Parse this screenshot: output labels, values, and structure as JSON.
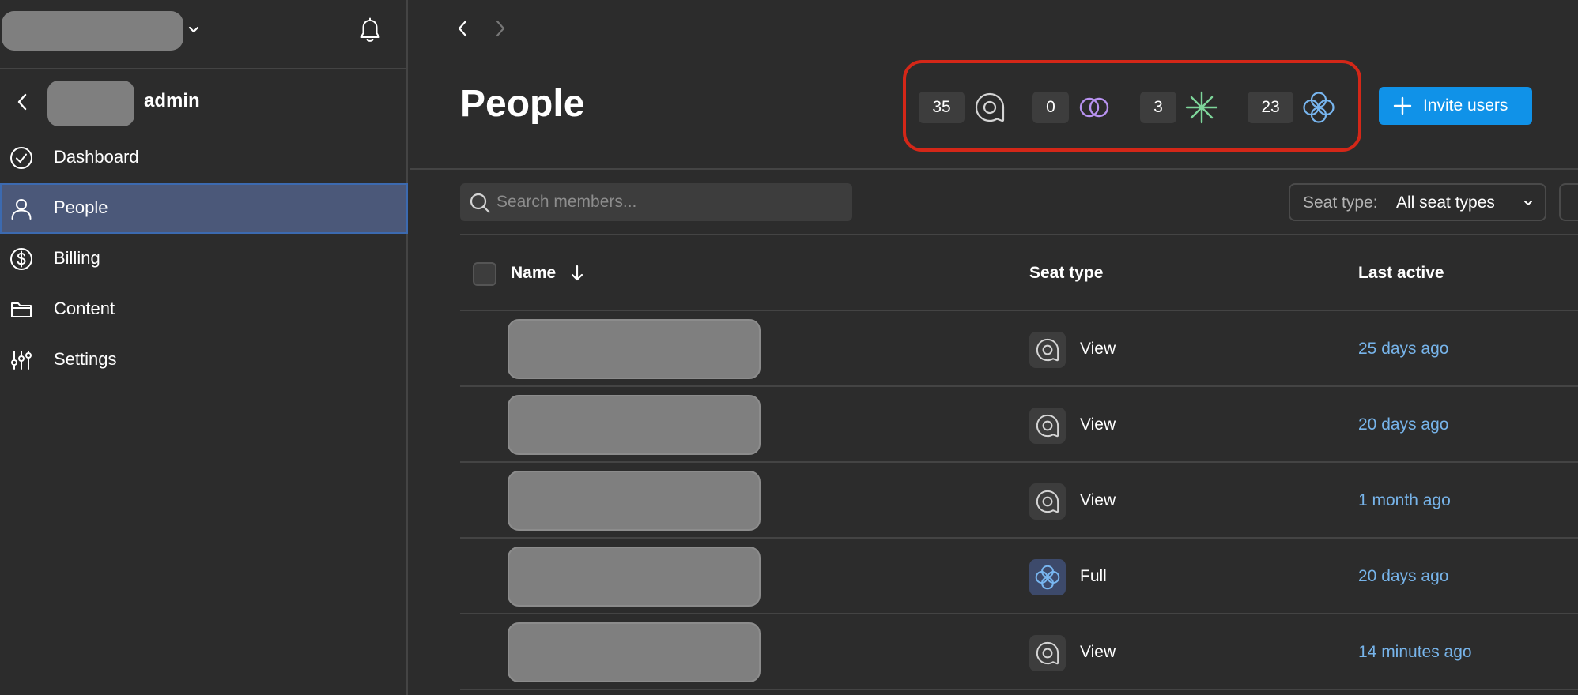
{
  "sidebar": {
    "admin_label": "admin",
    "nav": [
      {
        "label": "Dashboard",
        "icon": "check-circle-icon"
      },
      {
        "label": "People",
        "icon": "person-icon",
        "active": true
      },
      {
        "label": "Billing",
        "icon": "dollar-circle-icon"
      },
      {
        "label": "Content",
        "icon": "folder-icon"
      },
      {
        "label": "Settings",
        "icon": "sliders-icon"
      }
    ]
  },
  "header": {
    "title": "People",
    "seat_counts": [
      {
        "count": "35",
        "icon": "view-seat-icon"
      },
      {
        "count": "0",
        "icon": "collab-seat-icon"
      },
      {
        "count": "3",
        "icon": "dev-seat-icon"
      },
      {
        "count": "23",
        "icon": "full-seat-icon"
      }
    ],
    "invite_label": "Invite users"
  },
  "toolbar": {
    "search_placeholder": "Search members...",
    "filter_label": "Seat type:",
    "filter_value": "All seat types"
  },
  "table": {
    "columns": {
      "name": "Name",
      "seat_type": "Seat type",
      "last_active": "Last active"
    },
    "rows": [
      {
        "seat": "View",
        "seat_icon": "view-seat-icon",
        "last_active": "25 days ago"
      },
      {
        "seat": "View",
        "seat_icon": "view-seat-icon",
        "last_active": "20 days ago"
      },
      {
        "seat": "View",
        "seat_icon": "view-seat-icon",
        "last_active": "1 month ago"
      },
      {
        "seat": "Full",
        "seat_icon": "full-seat-icon",
        "last_active": "20 days ago"
      },
      {
        "seat": "View",
        "seat_icon": "view-seat-icon",
        "last_active": "14 minutes ago"
      }
    ]
  },
  "colors": {
    "accent": "#1092e8",
    "active_nav": "#4b5879",
    "highlight_border": "#d42718",
    "link": "#77b4ea",
    "collab_purple": "#b892f0",
    "dev_green": "#7ed69a",
    "full_blue": "#78b6f0"
  }
}
